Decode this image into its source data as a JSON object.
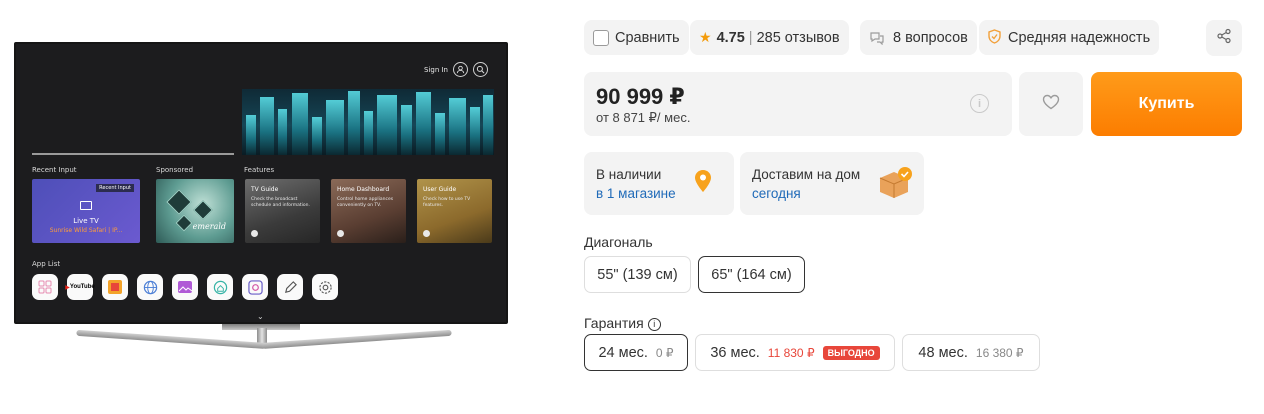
{
  "tv": {
    "sign_in": "Sign In",
    "sections": {
      "recent": "Recent Input",
      "sponsored": "Sponsored",
      "features": "Features"
    },
    "recent_card": {
      "badge": "Recent Input",
      "title": "Live TV",
      "subtitle": "Sunrise Wild Safari | IP..."
    },
    "sponsored_brand": "emerald",
    "features": [
      {
        "title": "TV Guide",
        "desc": "Check the broadcast schedule and information."
      },
      {
        "title": "Home Dashboard",
        "desc": "Control home appliances conveniently on TV."
      },
      {
        "title": "User Guide",
        "desc": "Check how to use TV features."
      }
    ],
    "app_list_label": "App List",
    "apps": [
      "apps-grid-icon",
      "youtube-icon",
      "store-icon",
      "browser-icon",
      "gallery-icon",
      "home-icon",
      "camera-icon",
      "edit-icon",
      "settings-icon"
    ],
    "youtube_label": "YouTube"
  },
  "toolbar": {
    "compare_label": "Сравнить",
    "rating": "4.75",
    "reviews": "285 отзывов",
    "questions": "8 вопросов",
    "reliability": "Средняя надежность"
  },
  "price": {
    "value": "90 999 ₽",
    "credit": "от 8 871 ₽/ мес.",
    "buy_label": "Купить"
  },
  "availability": {
    "stock_title": "В наличии",
    "stock_link": "в 1 магазине",
    "delivery_title": "Доставим на дом",
    "delivery_link": "сегодня"
  },
  "diagonal": {
    "label": "Диагональ",
    "options": [
      {
        "label": "55\" (139 см)",
        "selected": false
      },
      {
        "label": "65\" (164 см)",
        "selected": true
      }
    ]
  },
  "warranty": {
    "label": "Гарантия",
    "options": [
      {
        "label": "24 мес.",
        "price": "0 ₽",
        "selected": true
      },
      {
        "label": "36 мес.",
        "price": "11 830 ₽",
        "tag": "ВЫГОДНО",
        "selected": false
      },
      {
        "label": "48 мес.",
        "price": "16 380 ₽",
        "selected": false
      }
    ]
  },
  "colors": {
    "accent": "#fc7d00",
    "link": "#1f6ab8",
    "sale": "#e8463a",
    "star": "#f39b0b"
  }
}
